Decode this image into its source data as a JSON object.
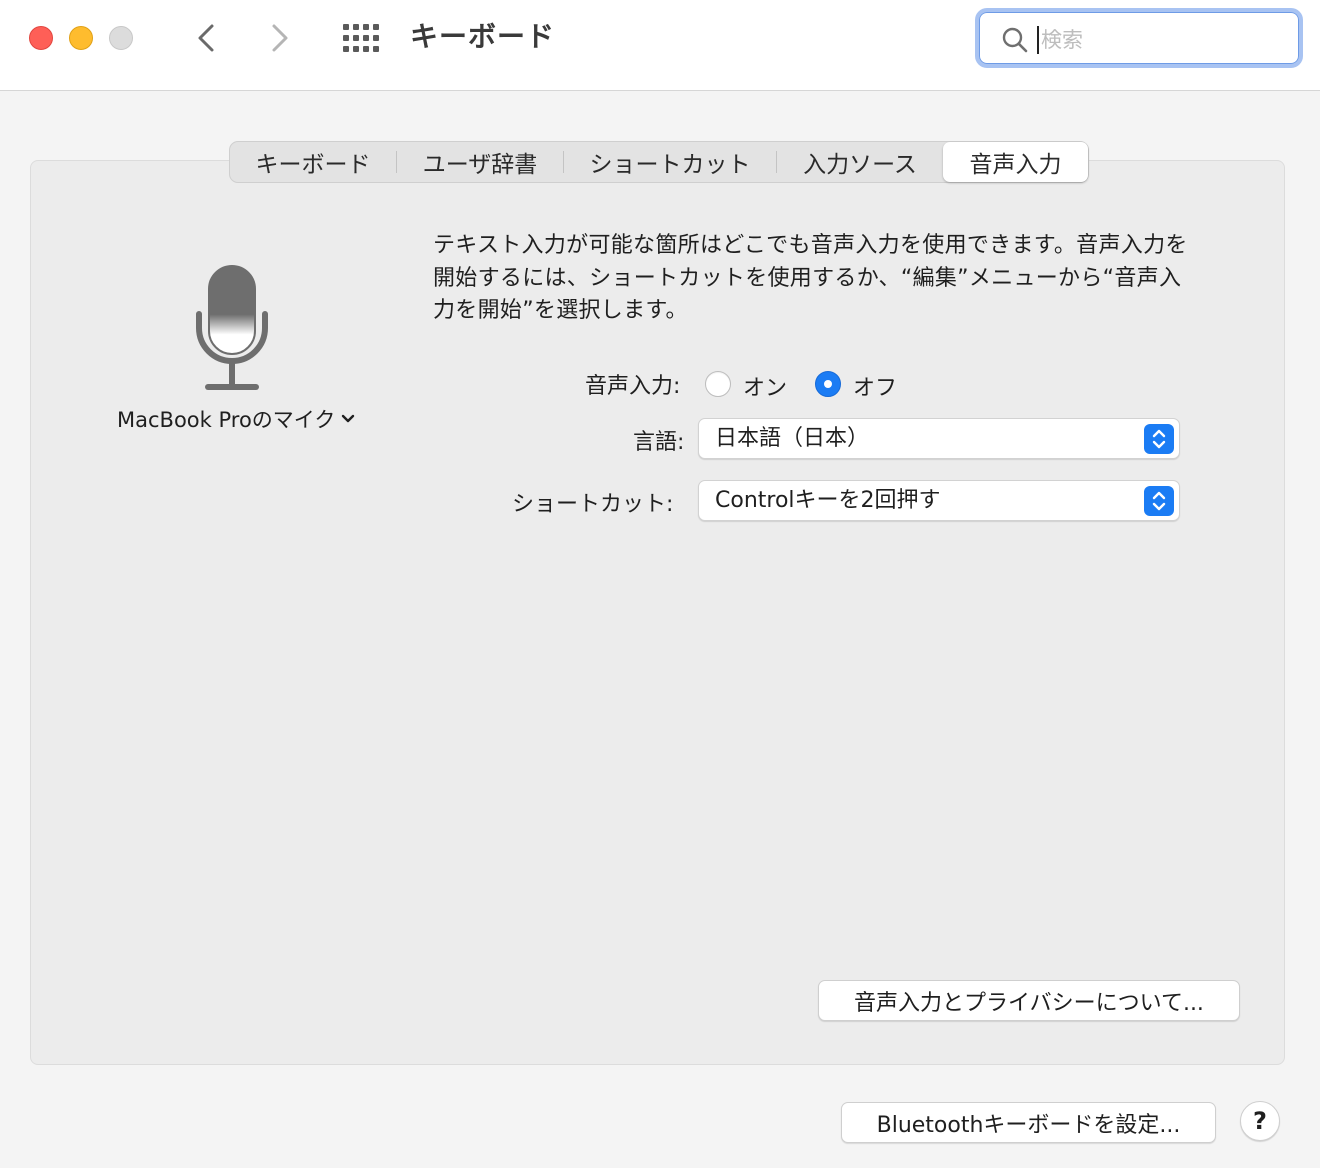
{
  "window": {
    "title": "キーボード",
    "search_placeholder": "検索"
  },
  "tabs": [
    {
      "label": "キーボード",
      "active": false
    },
    {
      "label": "ユーザ辞書",
      "active": false
    },
    {
      "label": "ショートカット",
      "active": false
    },
    {
      "label": "入力ソース",
      "active": false
    },
    {
      "label": "音声入力",
      "active": true
    }
  ],
  "dictation": {
    "mic_source": "MacBook Proのマイク",
    "description": "テキスト入力が可能な箇所はどこでも音声入力を使用できます。音声入力を開始するには、ショートカットを使用するか、“編集”メニューから“音声入力を開始”を選択します。",
    "toggle_label": "音声入力:",
    "option_on": "オン",
    "option_off": "オフ",
    "selected": "オフ",
    "language_label": "言語:",
    "language_value": "日本語（日本）",
    "shortcut_label": "ショートカット:",
    "shortcut_value": "Controlキーを2回押す",
    "privacy_button": "音声入力とプライバシーについて..."
  },
  "footer": {
    "bluetooth_button": "Bluetoothキーボードを設定...",
    "help_button": "?"
  },
  "colors": {
    "accent": "#1b7cf4",
    "close": "#fe5f57",
    "minimize": "#febc2e",
    "zoom_disabled": "#dcdcdc"
  },
  "icons": [
    "chevron-left-icon",
    "chevron-right-icon",
    "grid-icon",
    "search-icon",
    "microphone-icon",
    "chevron-down-icon",
    "up-down-arrows-icon"
  ]
}
